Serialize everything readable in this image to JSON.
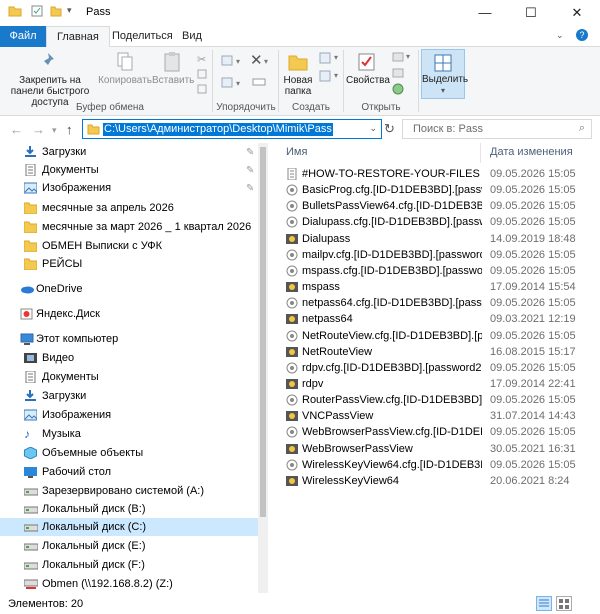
{
  "title": "Pass",
  "window_controls": {
    "minimize": "—",
    "maximize": "☐",
    "close": "✕"
  },
  "tabs": {
    "file": "Файл",
    "home": "Главная",
    "share": "Поделиться",
    "view": "Вид"
  },
  "ribbon": {
    "pin": "Закрепить на панели быстрого доступа",
    "copy": "Копировать",
    "paste": "Вставить",
    "clipboard_group": "Буфер обмена",
    "organize_group": "Упорядочить",
    "new_folder": "Новая папка",
    "create_group": "Создать",
    "properties": "Свойства",
    "open_group": "Открыть",
    "select": "Выделить"
  },
  "address": {
    "path": "C:\\Users\\Администратор\\Desktop\\Mimik\\Pass",
    "search_placeholder": "Поиск в: Pass"
  },
  "nav": [
    {
      "label": "Загрузки",
      "icon": "download-icon",
      "pinned": true
    },
    {
      "label": "Документы",
      "icon": "documents-icon",
      "pinned": true
    },
    {
      "label": "Изображения",
      "icon": "pictures-icon",
      "pinned": true
    },
    {
      "label": "месячные за апрель 2026",
      "icon": "folder-icon"
    },
    {
      "label": "месячные за март 2026 _ 1 квартал 2026",
      "icon": "folder-icon"
    },
    {
      "label": "ОБМЕН Выписки с УФК",
      "icon": "folder-icon"
    },
    {
      "label": "РЕЙСЫ",
      "icon": "folder-icon"
    },
    {
      "label": "OneDrive",
      "icon": "onedrive-icon"
    },
    {
      "label": "Яндекс.Диск",
      "icon": "yandex-disk-icon"
    },
    {
      "label": "Этот компьютер",
      "icon": "computer-icon"
    },
    {
      "label": "Видео",
      "icon": "video-icon"
    },
    {
      "label": "Документы",
      "icon": "documents-icon"
    },
    {
      "label": "Загрузки",
      "icon": "download-icon"
    },
    {
      "label": "Изображения",
      "icon": "pictures-icon"
    },
    {
      "label": "Музыка",
      "icon": "music-icon"
    },
    {
      "label": "Объемные объекты",
      "icon": "3d-objects-icon"
    },
    {
      "label": "Рабочий стол",
      "icon": "desktop-icon"
    },
    {
      "label": "Зарезервировано системой (A:)",
      "icon": "drive-icon"
    },
    {
      "label": "Локальный диск (B:)",
      "icon": "drive-icon"
    },
    {
      "label": "Локальный диск (C:)",
      "icon": "drive-icon",
      "selected": true
    },
    {
      "label": "Локальный диск (E:)",
      "icon": "drive-icon"
    },
    {
      "label": "Локальный диск (F:)",
      "icon": "drive-icon"
    },
    {
      "label": "Obmen (\\\\192.168.8.2) (Z:)",
      "icon": "network-drive-icon"
    }
  ],
  "columns": {
    "name": "Имя",
    "date": "Дата изменения"
  },
  "files": [
    {
      "name": "#HOW-TO-RESTORE-YOUR-FILES",
      "date": "09.05.2026 15:05",
      "icon": "text-file-icon"
    },
    {
      "name": "BasicProg.cfg.[ID-D1DEB3BD].[password...",
      "date": "09.05.2026 15:05",
      "icon": "generic-file-icon"
    },
    {
      "name": "BulletsPassView64.cfg.[ID-D1DEB3BD].[p...",
      "date": "09.05.2026 15:05",
      "icon": "generic-file-icon"
    },
    {
      "name": "Dialupass.cfg.[ID-D1DEB3BD].[password2...",
      "date": "09.05.2026 15:05",
      "icon": "generic-file-icon"
    },
    {
      "name": "Dialupass",
      "date": "14.09.2019 18:48",
      "icon": "app-icon"
    },
    {
      "name": "mailpv.cfg.[ID-D1DEB3BD].[password2@t...",
      "date": "09.05.2026 15:05",
      "icon": "generic-file-icon"
    },
    {
      "name": "mspass.cfg.[ID-D1DEB3BD].[password2@...",
      "date": "09.05.2026 15:05",
      "icon": "generic-file-icon"
    },
    {
      "name": "mspass",
      "date": "17.09.2014 15:54",
      "icon": "app-icon"
    },
    {
      "name": "netpass64.cfg.[ID-D1DEB3BD].[password...",
      "date": "09.05.2026 15:05",
      "icon": "generic-file-icon"
    },
    {
      "name": "netpass64",
      "date": "09.03.2021 12:19",
      "icon": "app-icon"
    },
    {
      "name": "NetRouteView.cfg.[ID-D1DEB3BD].[passw...",
      "date": "09.05.2026 15:05",
      "icon": "generic-file-icon"
    },
    {
      "name": "NetRouteView",
      "date": "16.08.2015 15:17",
      "icon": "app-icon"
    },
    {
      "name": "rdpv.cfg.[ID-D1DEB3BD].[password2@tut...",
      "date": "09.05.2026 15:05",
      "icon": "generic-file-icon"
    },
    {
      "name": "rdpv",
      "date": "17.09.2014 22:41",
      "icon": "app-icon"
    },
    {
      "name": "RouterPassView.cfg.[ID-D1DEB3BD].[pass...",
      "date": "09.05.2026 15:05",
      "icon": "generic-file-icon"
    },
    {
      "name": "VNCPassView",
      "date": "31.07.2014 14:43",
      "icon": "app-icon"
    },
    {
      "name": "WebBrowserPassView.cfg.[ID-D1DEB3BD]...",
      "date": "09.05.2026 15:05",
      "icon": "generic-file-icon"
    },
    {
      "name": "WebBrowserPassView",
      "date": "30.05.2021 16:31",
      "icon": "app-icon"
    },
    {
      "name": "WirelessKeyView64.cfg.[ID-D1DEB3BD].[p...",
      "date": "09.05.2026 15:05",
      "icon": "generic-file-icon"
    },
    {
      "name": "WirelessKeyView64",
      "date": "20.06.2021 8:24",
      "icon": "app-icon"
    }
  ],
  "status": {
    "count": "Элементов: 20"
  },
  "colors": {
    "accent": "#0078d7",
    "file_tab": "#1979ca",
    "selected_bg": "#cce8ff"
  }
}
